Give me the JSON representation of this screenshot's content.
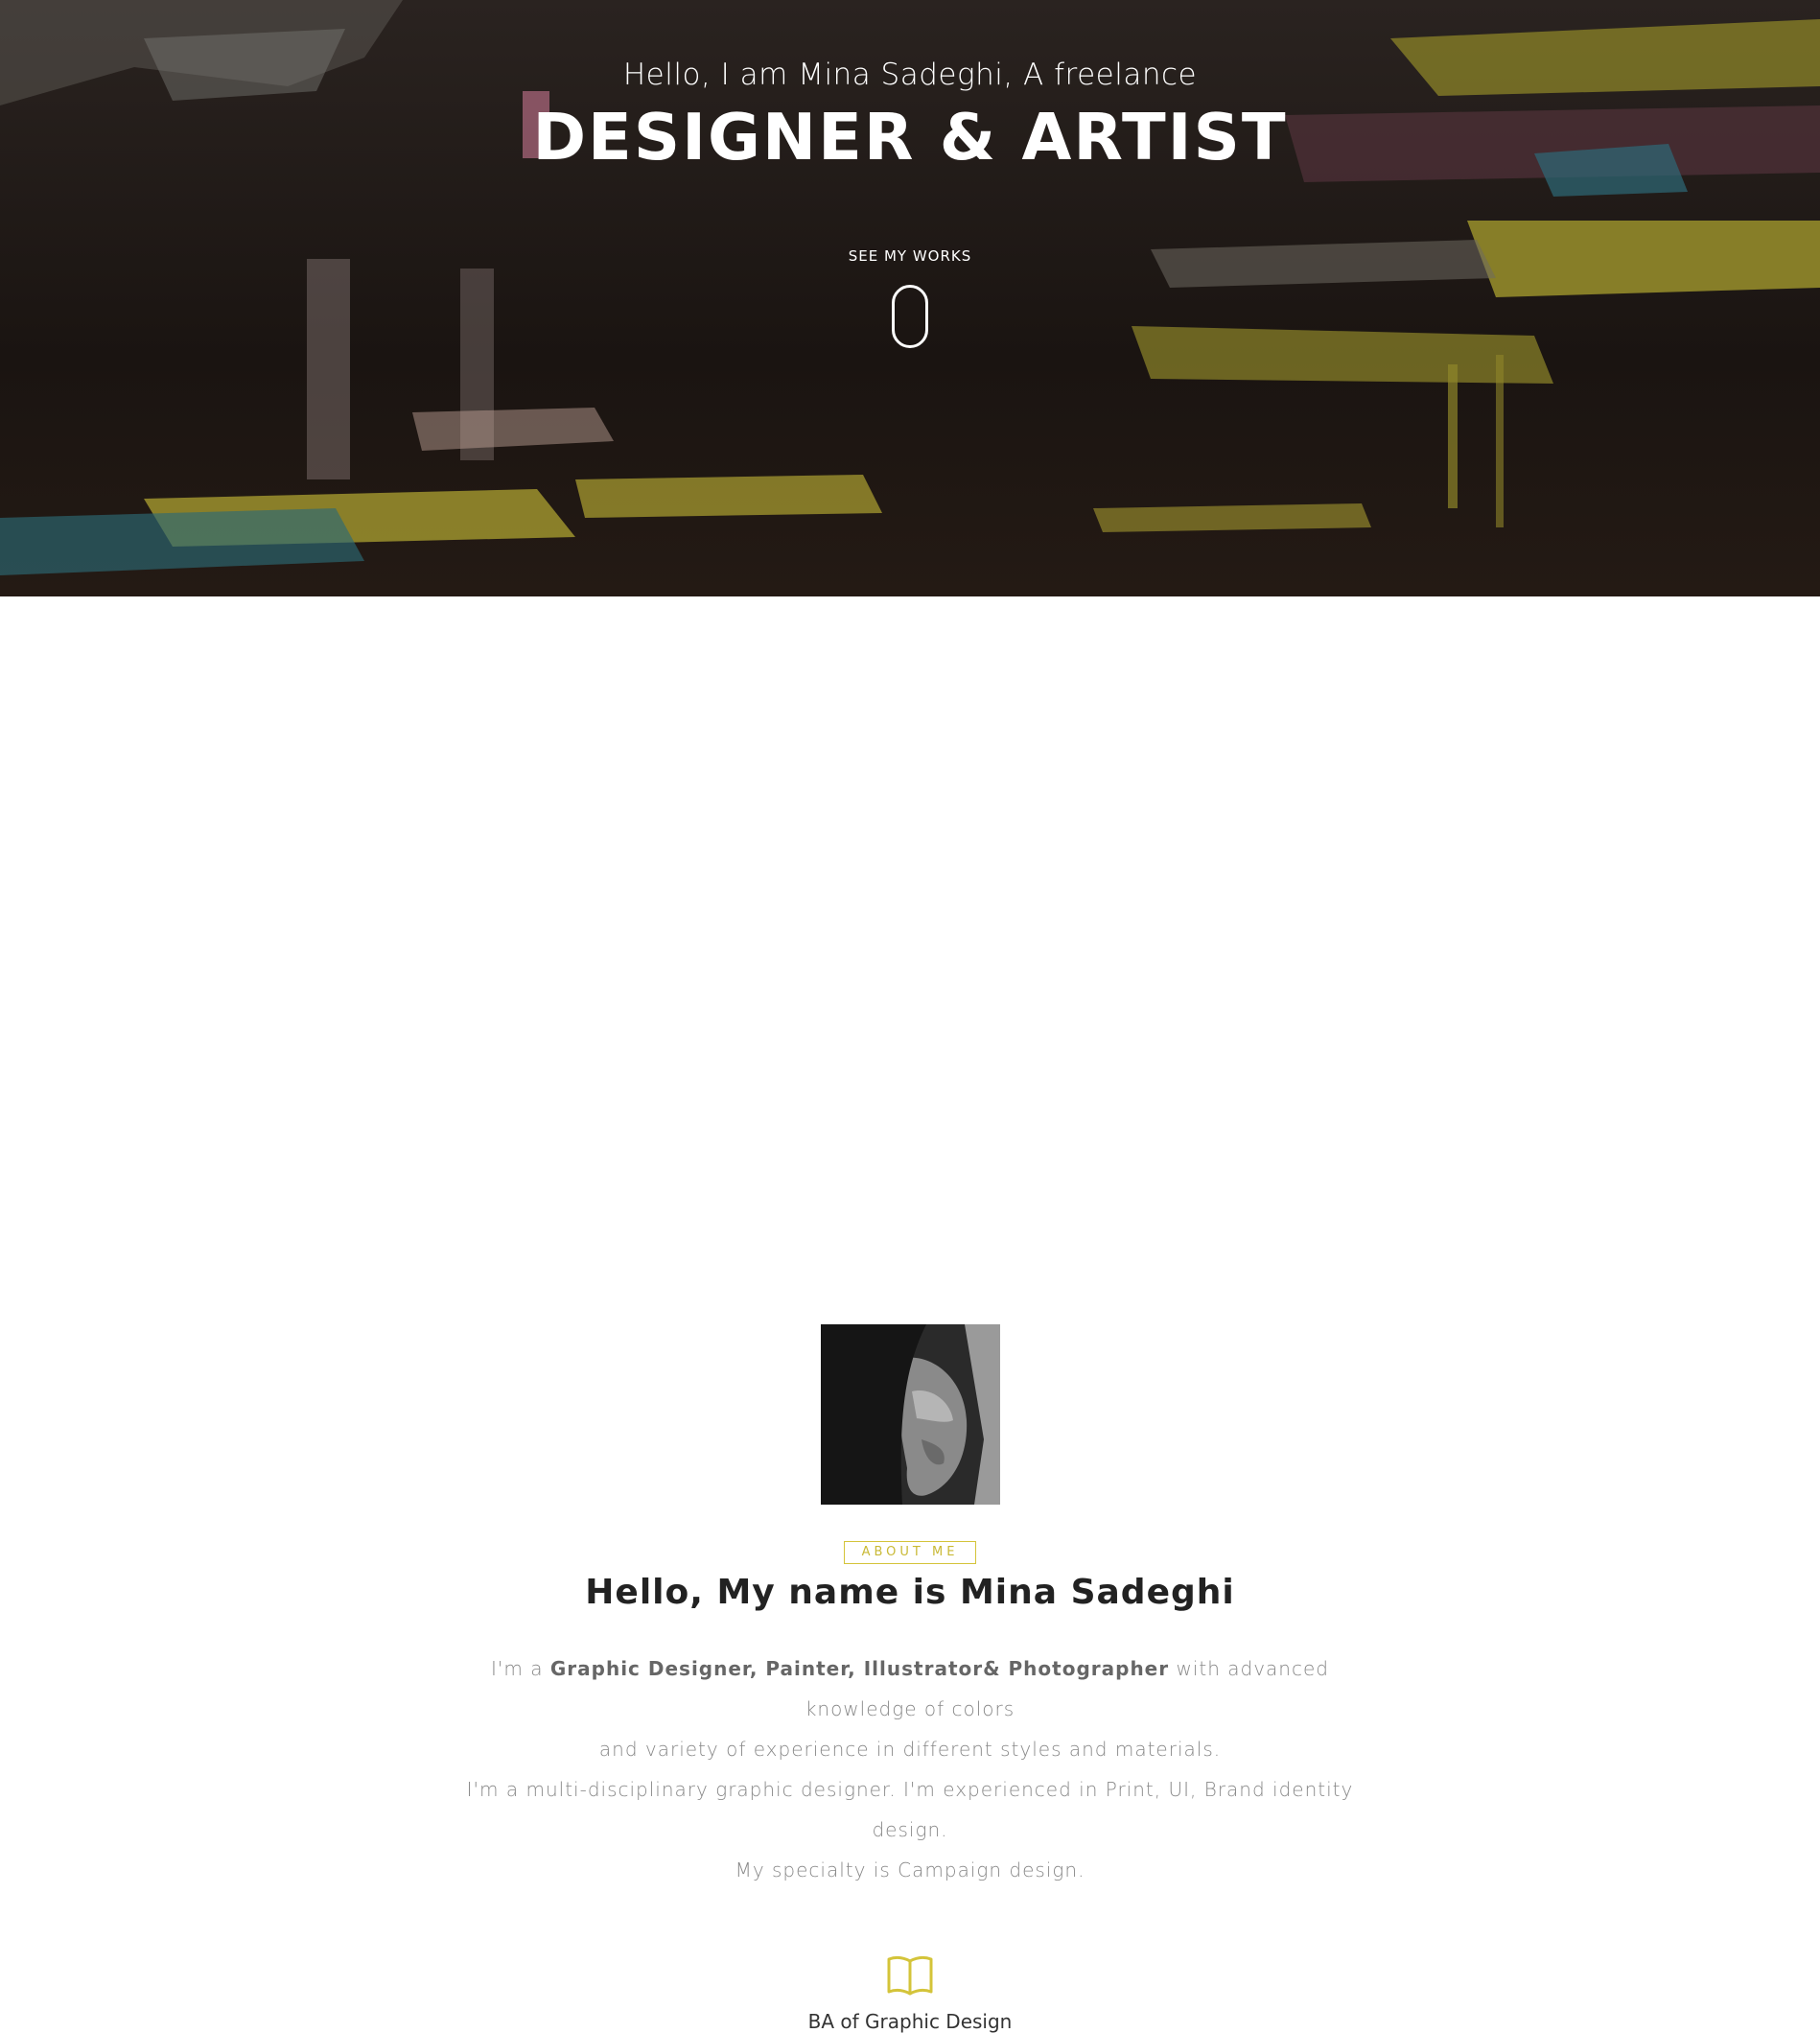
{
  "hero": {
    "subtitle": "Hello, I am Mina Sadeghi, A freelance",
    "title": "DESIGNER & ARTIST",
    "cta_label": "SEE MY WORKS",
    "scroll_icon": "mouse-scroll-icon"
  },
  "about": {
    "avatar_icon": "portrait-photo",
    "badge": "ABOUT ME",
    "title": "Hello, My name is Mina Sadeghi",
    "bio": {
      "intro_prefix": "I'm a ",
      "roles": "Graphic Designer, Painter, Illustrator& Photographer",
      "intro_suffix": " with advanced knowledge of colors",
      "line2": "and variety of experience in different styles and materials.",
      "line3": "I'm a multi-disciplinary graphic designer. I'm experienced in Print, UI, Brand identity design.",
      "line4": "My specialty is Campaign design."
    }
  },
  "education": {
    "icon": "open-book-icon",
    "label": "BA of Graphic Design"
  },
  "colors": {
    "accent": "#d4c43a",
    "text_dark": "#222222",
    "text_muted": "#888888"
  }
}
